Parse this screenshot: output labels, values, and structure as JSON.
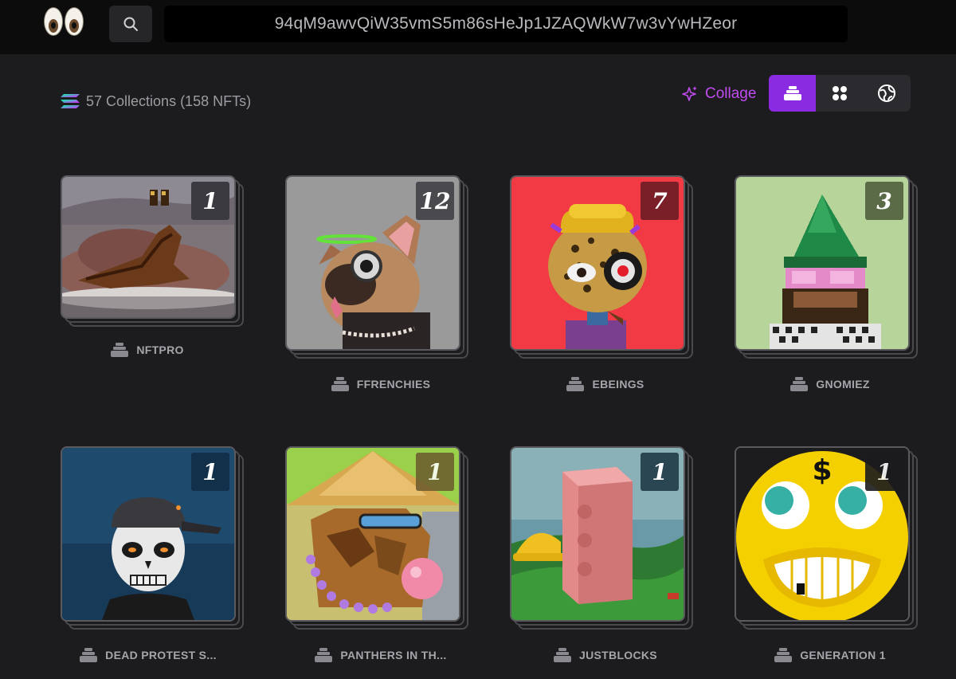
{
  "header": {
    "logo_icon": "eyes-icon",
    "search_icon": "search-icon",
    "address": "94qM9awvQiW35vmS5m86sHeJp1JZAQWkW7w3vYwHZeor"
  },
  "toolbar": {
    "chain_icon": "solana-icon",
    "summary": "57 Collections (158 NFTs)",
    "collage_label": "Collage",
    "collage_icon": "sparkles-icon",
    "views": [
      {
        "name": "stack-view",
        "icon": "stack-icon",
        "active": true
      },
      {
        "name": "grid-view",
        "icon": "grid-icon",
        "active": false
      },
      {
        "name": "globe-view",
        "icon": "globe-icon",
        "active": false
      }
    ],
    "accent_color": "#8a2be2"
  },
  "collections": [
    {
      "name": "NFTPRO",
      "count": "1",
      "badge_color": "#3a3a40"
    },
    {
      "name": "FFRENCHIES",
      "count": "12",
      "badge_color": "#4a4a4e"
    },
    {
      "name": "EBEINGS",
      "count": "7",
      "badge_color": "#7a1f27"
    },
    {
      "name": "GNOMIEZ",
      "count": "3",
      "badge_color": "#5b6a47"
    },
    {
      "name": "DEAD PROTEST S...",
      "count": "1",
      "badge_color": "#12304a"
    },
    {
      "name": "PANTHERS IN TH...",
      "count": "1",
      "badge_color": "#6b5a2e"
    },
    {
      "name": "JUSTBLOCKS",
      "count": "1",
      "badge_color": "#2a4652"
    },
    {
      "name": "GENERATION 1",
      "count": "1",
      "badge_color": "#1b1b1d"
    }
  ]
}
